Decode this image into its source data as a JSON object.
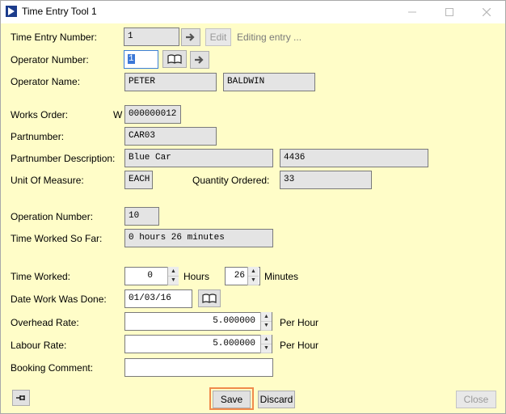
{
  "window": {
    "title": "Time Entry Tool 1"
  },
  "time_entry": {
    "label": "Time Entry Number:",
    "value": "1",
    "edit_label": "Edit",
    "status": "Editing entry ..."
  },
  "operator_number": {
    "label": "Operator Number:",
    "value": "1"
  },
  "operator_name": {
    "label": "Operator Name:",
    "first": "PETER",
    "last": "BALDWIN"
  },
  "works_order": {
    "label": "Works Order:",
    "prefix": "W",
    "value": "000000012"
  },
  "partnumber": {
    "label": "Partnumber:",
    "value": "CAR03"
  },
  "partnumber_description": {
    "label": "Partnumber Description:",
    "value": "Blue Car",
    "extra": "4436"
  },
  "unit_of_measure": {
    "label": "Unit Of Measure:",
    "value": "EACH"
  },
  "quantity_ordered": {
    "label": "Quantity Ordered:",
    "value": "33"
  },
  "operation_number": {
    "label": "Operation Number:",
    "value": "10"
  },
  "time_worked_so_far": {
    "label": "Time Worked So Far:",
    "value": "0 hours 26 minutes"
  },
  "time_worked": {
    "label": "Time Worked:",
    "hours": "0",
    "hours_label": "Hours",
    "minutes": "26",
    "minutes_label": "Minutes"
  },
  "date_work_done": {
    "label": "Date Work Was Done:",
    "value": "01/03/16"
  },
  "overhead_rate": {
    "label": "Overhead Rate:",
    "value": "5.000000",
    "unit": "Per Hour"
  },
  "labour_rate": {
    "label": "Labour Rate:",
    "value": "5.000000",
    "unit": "Per Hour"
  },
  "booking_comment": {
    "label": "Booking Comment:",
    "value": ""
  },
  "buttons": {
    "save": "Save",
    "discard": "Discard",
    "close": "Close"
  },
  "colors": {
    "background": "#fffdc8",
    "focus_outline": "#f08a4b"
  }
}
